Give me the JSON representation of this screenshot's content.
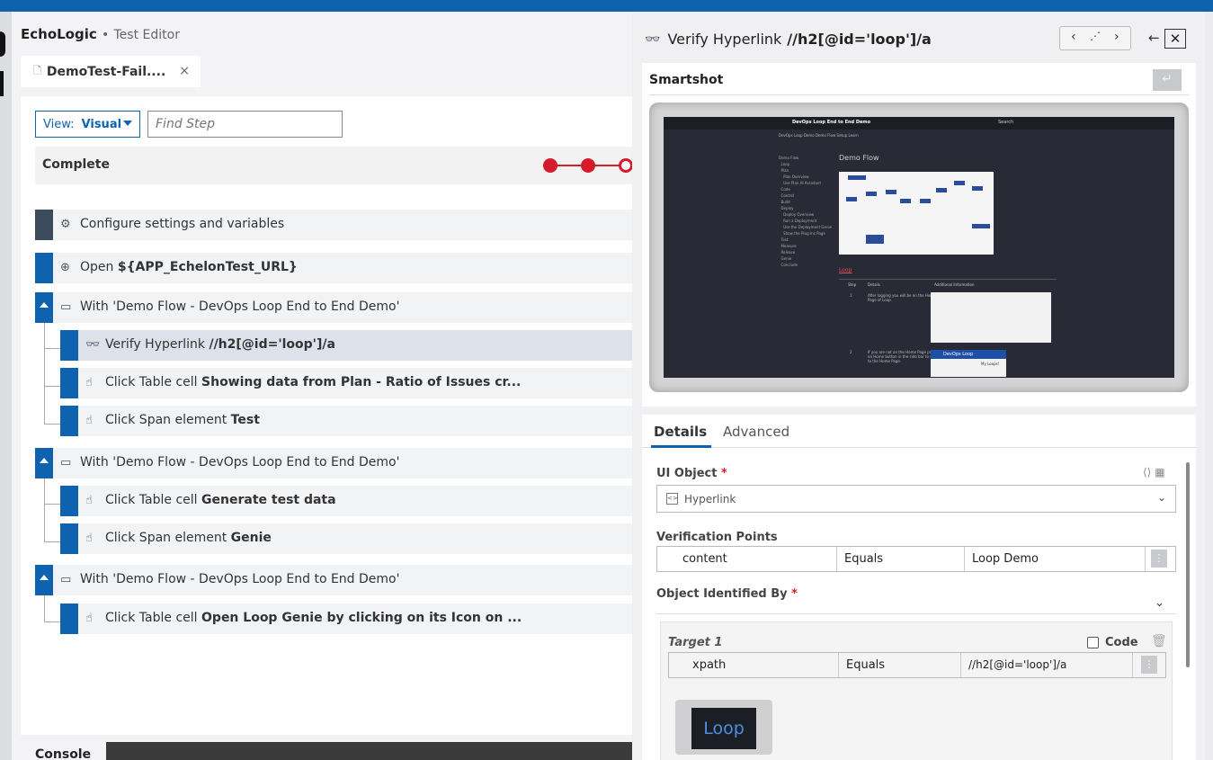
{
  "app": {
    "name": "EchoLogic",
    "separator": "•",
    "subtitle": "Test Editor"
  },
  "tab": {
    "label": "DemoTest-Fail....",
    "close": "×"
  },
  "toolbar": {
    "view_label": "View:",
    "view_value": "Visual",
    "find_placeholder": "Find Step"
  },
  "status": {
    "label": "Complete",
    "progress": {
      "passed": 2,
      "failed_current": 1
    }
  },
  "steps": [
    {
      "prefix": "Configure settings and variables",
      "bold": ""
    },
    {
      "prefix": "Open ",
      "bold": "${APP_EchelonTest_URL}"
    },
    {
      "prefix": "With 'Demo Flow - DevOps Loop End to End Demo'",
      "bold": ""
    },
    {
      "prefix": "Verify Hyperlink ",
      "bold": "//h2[@id='loop']/a"
    },
    {
      "prefix": "Click Table cell ",
      "bold": "Showing data from Plan - Ratio of Issues cr..."
    },
    {
      "prefix": "Click Span element ",
      "bold": "Test"
    },
    {
      "prefix": "With 'Demo Flow - DevOps Loop End to End Demo'",
      "bold": ""
    },
    {
      "prefix": "Click Table cell ",
      "bold": "Generate test data"
    },
    {
      "prefix": "Click Span element ",
      "bold": "Genie"
    },
    {
      "prefix": "With 'Demo Flow - DevOps Loop End to End Demo'",
      "bold": ""
    },
    {
      "prefix": "Click Table cell ",
      "bold": "Open Loop Genie by clicking on its Icon on ..."
    }
  ],
  "console": {
    "label": "Console"
  },
  "panel": {
    "title_prefix": "Verify Hyperlink",
    "title_bold": "//h2[@id='loop']/a",
    "smartshot": {
      "label": "Smartshot",
      "screenshot": {
        "title": "DevOps Loop End to End Demo",
        "search": "Search",
        "subnav": "DevOps Loop Demo    Demo Flow    Setup    Learn",
        "sidebar": "Demo Flow\n  Loop\n  Plan\n    Plan Overview\n    Use Plan AI Assistant\n  Code\n  Control\n  Build\n  Deploy\n    Deploy Overview\n    Run a Deployment\n    Use the Deployment Genie\n    Show the Plug-Ins Page\n  Test\n  Measure\n  Release\n  Genie\n  Conclude",
        "heading": "Demo Flow",
        "link": "Loop",
        "col_step": "Step",
        "col_details": "Details",
        "col_info": "Additional Information",
        "row1_num": "1",
        "row1_text": "After logging you will be on the Home\nPage of Loop.",
        "row2_num": "2",
        "row2_text": "If you are not on the Home Page page, click\non Home button in the side bar to switch\nto the Home Page.",
        "thumb2_title": "DevOps Loop",
        "thumb2_sub": "My Loops!"
      }
    },
    "tabs": {
      "details": "Details",
      "advanced": "Advanced"
    },
    "ui_object": {
      "label": "UI Object",
      "value": "Hyperlink"
    },
    "verification": {
      "label": "Verification Points",
      "property": "content",
      "operator": "Equals",
      "value": "Loop Demo"
    },
    "identified_by": {
      "label": "Object Identified By"
    },
    "target": {
      "label": "Target 1",
      "code_label": "Code",
      "property": "xpath",
      "operator": "Equals",
      "value": "//h2[@id='loop']/a",
      "preview": "Loop"
    }
  },
  "colors": {
    "accent": "#0f62ae",
    "fail": "#d7192c"
  }
}
